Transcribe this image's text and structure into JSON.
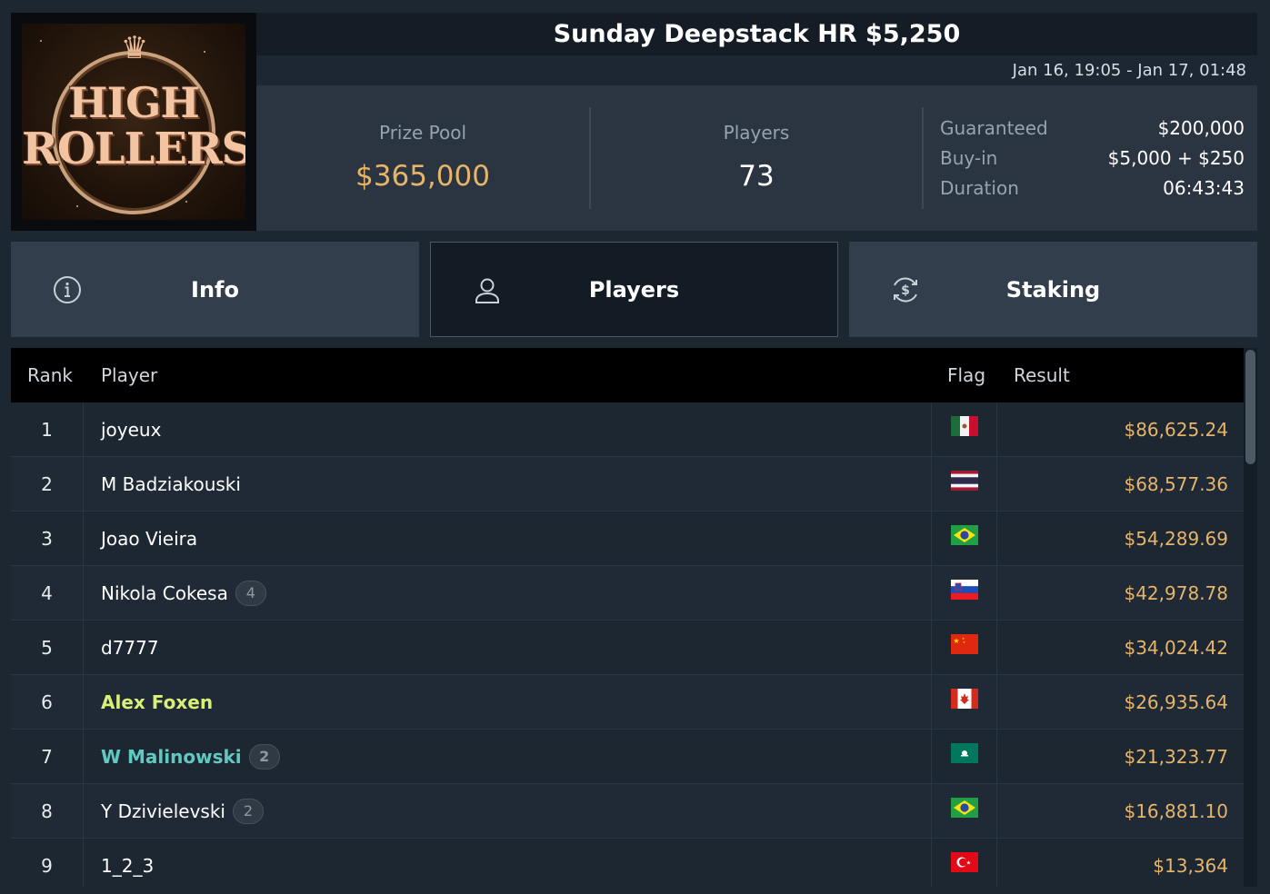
{
  "tournament": {
    "title": "Sunday Deepstack HR $5,250",
    "dates": "Jan 16, 19:05 - Jan 17, 01:48",
    "logo_text_line1": "HIGH",
    "logo_text_line2": "ROLLERS"
  },
  "stats": {
    "prize_pool_label": "Prize Pool",
    "prize_pool_value": "$365,000",
    "players_label": "Players",
    "players_value": "73"
  },
  "details": [
    {
      "key": "Guaranteed",
      "value": "$200,000"
    },
    {
      "key": "Buy-in",
      "value": "$5,000 + $250"
    },
    {
      "key": "Duration",
      "value": "06:43:43"
    }
  ],
  "tabs": [
    {
      "label": "Info",
      "icon": "info-icon"
    },
    {
      "label": "Players",
      "icon": "user-icon",
      "active": true
    },
    {
      "label": "Staking",
      "icon": "dollar-refresh-icon"
    }
  ],
  "table": {
    "headers": {
      "rank": "Rank",
      "player": "Player",
      "flag": "Flag",
      "result": "Result"
    },
    "rows": [
      {
        "rank": "1",
        "player": "joyeux",
        "badge": "",
        "flag": "mexico-flag",
        "result": "$86,625.24",
        "highlight": ""
      },
      {
        "rank": "2",
        "player": "M Badziakouski",
        "badge": "",
        "flag": "thailand-flag",
        "result": "$68,577.36",
        "highlight": ""
      },
      {
        "rank": "3",
        "player": "Joao Vieira",
        "badge": "",
        "flag": "brazil-flag",
        "result": "$54,289.69",
        "highlight": ""
      },
      {
        "rank": "4",
        "player": "Nikola Cokesa",
        "badge": "4",
        "flag": "slovenia-flag",
        "result": "$42,978.78",
        "highlight": ""
      },
      {
        "rank": "5",
        "player": "d7777",
        "badge": "",
        "flag": "china-flag",
        "result": "$34,024.42",
        "highlight": ""
      },
      {
        "rank": "6",
        "player": "Alex Foxen",
        "badge": "",
        "flag": "canada-flag",
        "result": "$26,935.64",
        "highlight": "yellow"
      },
      {
        "rank": "7",
        "player": "W Malinowski",
        "badge": "2",
        "flag": "macau-flag",
        "result": "$21,323.77",
        "highlight": "teal"
      },
      {
        "rank": "8",
        "player": "Y Dzivielevski",
        "badge": "2",
        "flag": "brazil-flag",
        "result": "$16,881.10",
        "highlight": ""
      },
      {
        "rank": "9",
        "player": "1_2_3",
        "badge": "",
        "flag": "turkey-flag",
        "result": "$13,364",
        "highlight": ""
      }
    ]
  },
  "colors": {
    "gold": "#e7b46a",
    "highlight_yellow": "#d9ef76",
    "highlight_teal": "#60c9c1"
  }
}
